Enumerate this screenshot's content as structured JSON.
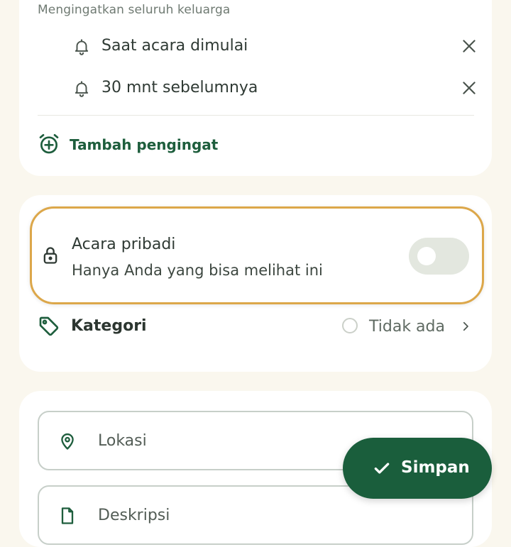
{
  "reminders_section": {
    "family_reminder_label": "Mengingatkan seluruh keluarga",
    "reminders": [
      {
        "label": "Saat acara dimulai",
        "icon": "bell-icon"
      },
      {
        "label": "30 mnt sebelumnya",
        "icon": "bell-icon"
      }
    ],
    "add_reminder_label": "Tambah pengingat"
  },
  "privacy": {
    "title": "Acara pribadi",
    "subtitle": "Hanya Anda yang bisa melihat ini",
    "toggle_on": false
  },
  "category": {
    "label": "Kategori",
    "value": "Tidak ada"
  },
  "fields": {
    "location_placeholder": "Lokasi",
    "description_placeholder": "Deskripsi"
  },
  "save_button": {
    "label": "Simpan"
  },
  "colors": {
    "background": "#faf7ee",
    "accent_green": "#1a5e3c",
    "highlight_border": "#dca74a",
    "toggle_off": "#e3e7df"
  }
}
